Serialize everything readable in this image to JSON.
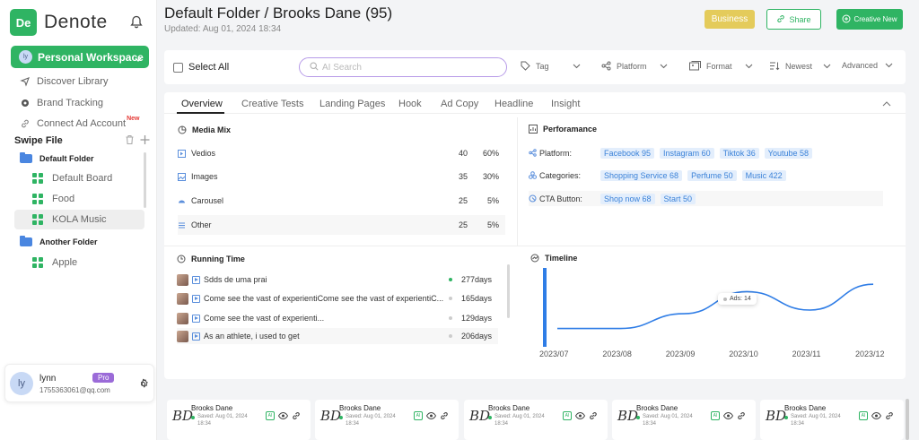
{
  "app": {
    "logo_mark": "De",
    "name": "Denote"
  },
  "workspace": {
    "avatar": "ly",
    "label": "Personal Workspace"
  },
  "nav": {
    "discover": "Discover Library",
    "brand": "Brand Tracking",
    "connect": "Connect Ad Account",
    "connect_badge": "New"
  },
  "swipe_file": {
    "title": "Swipe File",
    "folders": [
      {
        "name": "Default Folder",
        "boards": [
          "Default Board",
          "Food",
          "KOLA Music"
        ]
      },
      {
        "name": "Another Folder",
        "boards": [
          "Apple"
        ]
      }
    ]
  },
  "user": {
    "avatar": "ly",
    "name": "lynn",
    "email": "1755363061@qq.com",
    "plan": "Pro"
  },
  "header": {
    "title": "Default Folder / Brooks Dane (95)",
    "updated": "Updated: Aug 01, 2024 18:34",
    "business_btn": "Business",
    "share_btn": "Share",
    "create_btn": "Creative New"
  },
  "toolbar": {
    "select_all": "Select  All",
    "search_placeholder": "AI Search",
    "tag": "Tag",
    "platform": "Platform",
    "format": "Format",
    "sort": "Newest",
    "advanced": "Advanced"
  },
  "tabs": [
    "Overview",
    "Creative Tests",
    "Landing Pages",
    "Hook",
    "Ad Copy",
    "Headline",
    "Insight"
  ],
  "media_mix": {
    "title": "Media Mix",
    "rows": [
      {
        "label": "Vedios",
        "count": "40",
        "pct": "60%"
      },
      {
        "label": "Images",
        "count": "35",
        "pct": "30%"
      },
      {
        "label": "Carousel",
        "count": "25",
        "pct": "5%"
      },
      {
        "label": "Other",
        "count": "25",
        "pct": "5%"
      }
    ]
  },
  "performance": {
    "title": "Perforamance",
    "platform_label": "Platform:",
    "platform_chips": [
      "Facebook  95",
      "Instagram  60",
      "Tiktok  36",
      "Youtube  58"
    ],
    "categories_label": "Categories:",
    "category_chips": [
      "Shopping Service  68",
      "Perfume  50",
      "Music 422"
    ],
    "cta_label": "CTA Button:",
    "cta_chips": [
      "Shop now  68",
      "Start  50"
    ]
  },
  "running_time": {
    "title": "Running Time",
    "rows": [
      {
        "text": "Sdds de uma prai",
        "days": "277days",
        "status": "active"
      },
      {
        "text": "Come see the vast of experientiCome see the vast of experientiC...",
        "days": "165days",
        "status": "inactive"
      },
      {
        "text": "Come see the vast of experienti...",
        "days": "129days",
        "status": "inactive"
      },
      {
        "text": "As an athlete, i used to get",
        "days": "206days",
        "status": "inactive"
      }
    ]
  },
  "timeline": {
    "title": "Timeline",
    "tooltip": "Ads: 14",
    "accent": "#2f7de6"
  },
  "chart_data": {
    "type": "line",
    "title": "Timeline",
    "x": [
      "2023/07",
      "2023/08",
      "2023/09",
      "2023/10",
      "2023/11",
      "2023/12"
    ],
    "series": [
      {
        "values": [
          4,
          4,
          8,
          14,
          9,
          16
        ]
      }
    ],
    "tooltip": {
      "x": "2023/10",
      "label": "Ads: 14"
    },
    "grid": false
  },
  "cards": [
    {
      "logo": "BD",
      "name": "Brooks Dane",
      "saved": "Saved: Aug 01, 2024",
      "time": "18:34",
      "ai": "AI"
    },
    {
      "logo": "BD",
      "name": "Brooks Dane",
      "saved": "Saved: Aug 01, 2024",
      "time": "18:34",
      "ai": "AI"
    },
    {
      "logo": "BD",
      "name": "Brooks Dane",
      "saved": "Saved: Aug 01, 2024",
      "time": "18:34",
      "ai": "AI"
    },
    {
      "logo": "BD",
      "name": "Brooks Dane",
      "saved": "Saved: Aug 01, 2024",
      "time": "18:34",
      "ai": "AI"
    },
    {
      "logo": "BD",
      "name": "Brooks Dane",
      "saved": "Saved: Aug 01, 2024",
      "time": "18:34",
      "ai": "AI"
    }
  ],
  "colors": {
    "brand": "#2fb463",
    "business": "#e4cb5b",
    "pro": "#9b6bd8",
    "chip_bg": "#e3eefc",
    "chip_text": "#3b82d8"
  }
}
